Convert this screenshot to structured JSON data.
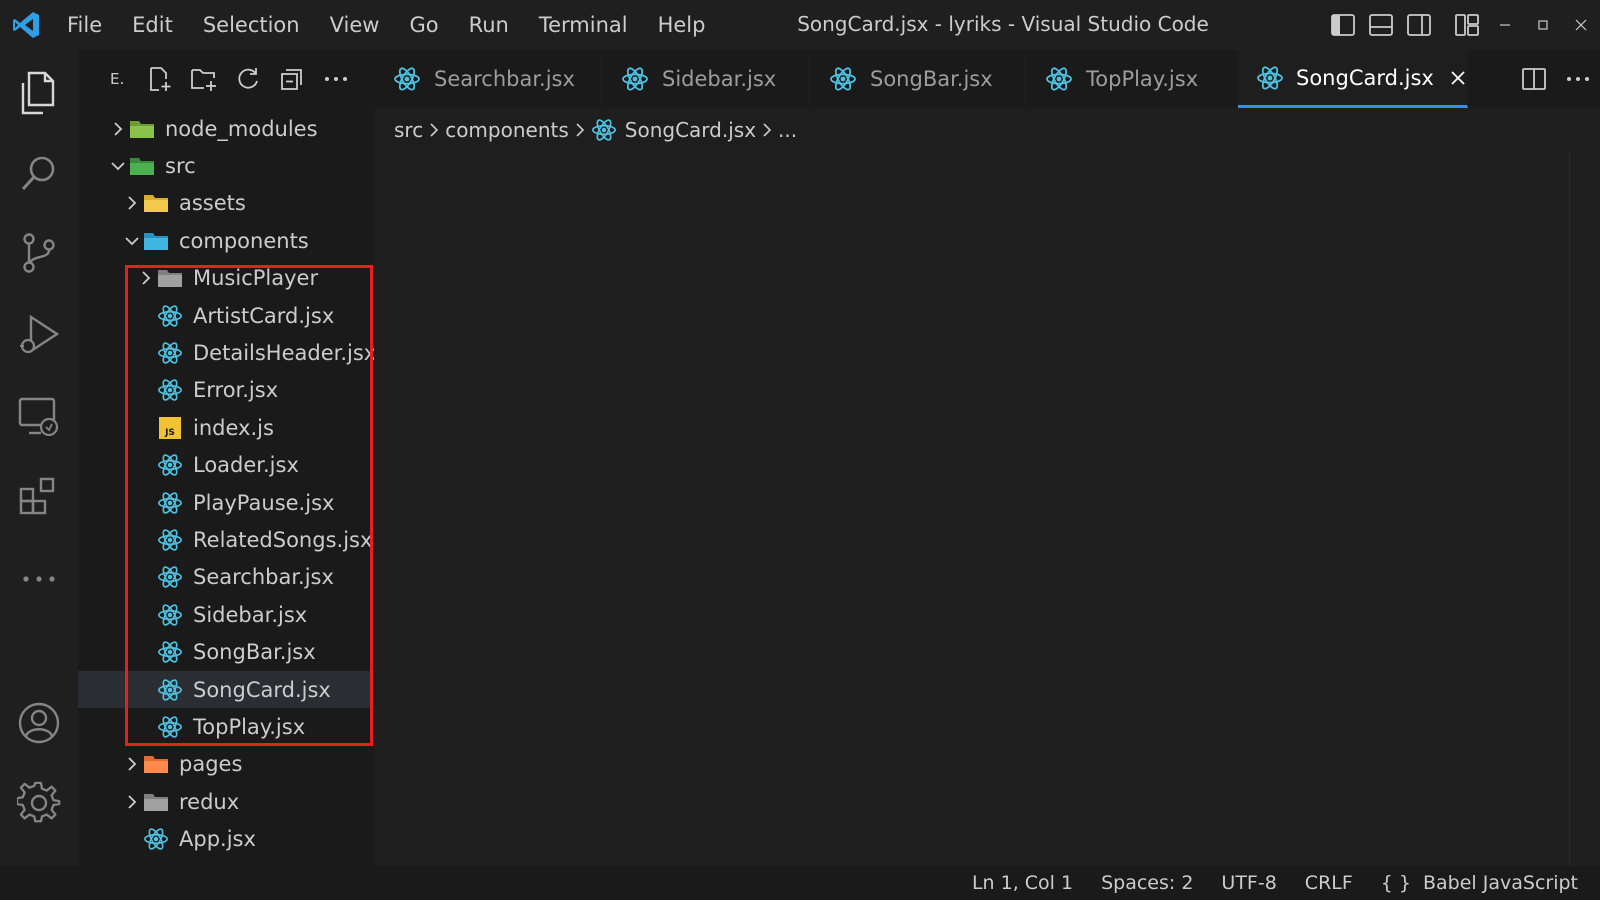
{
  "window": {
    "title": "SongCard.jsx - lyriks - Visual Studio Code",
    "accent_color": "#3c8dde",
    "highlight_color": "#e81f1f"
  },
  "menu": [
    "File",
    "Edit",
    "Selection",
    "View",
    "Go",
    "Run",
    "Terminal",
    "Help"
  ],
  "activity_bar": {
    "icons": [
      "files-icon",
      "search-icon",
      "source-control-icon",
      "run-debug-icon",
      "remote-explorer-icon",
      "extensions-icon",
      "more-icon",
      "account-icon",
      "settings-gear-icon"
    ]
  },
  "explorer": {
    "title": "E."
  },
  "tree": [
    {
      "label": "node_modules",
      "indent": 0,
      "type": "folder",
      "expanded": false,
      "icon": "folder-node-icon"
    },
    {
      "label": "src",
      "indent": 0,
      "type": "folder",
      "expanded": true,
      "icon": "folder-src-icon"
    },
    {
      "label": "assets",
      "indent": 1,
      "type": "folder",
      "expanded": false,
      "icon": "folder-assets-icon"
    },
    {
      "label": "components",
      "indent": 1,
      "type": "folder",
      "expanded": true,
      "icon": "folder-components-icon"
    },
    {
      "label": "MusicPlayer",
      "indent": 2,
      "type": "folder",
      "expanded": false,
      "icon": "folder-icon"
    },
    {
      "label": "ArtistCard.jsx",
      "indent": 2,
      "type": "file",
      "icon": "react-icon"
    },
    {
      "label": "DetailsHeader.jsx",
      "indent": 2,
      "type": "file",
      "icon": "react-icon"
    },
    {
      "label": "Error.jsx",
      "indent": 2,
      "type": "file",
      "icon": "react-icon"
    },
    {
      "label": "index.js",
      "indent": 2,
      "type": "file",
      "icon": "js-icon"
    },
    {
      "label": "Loader.jsx",
      "indent": 2,
      "type": "file",
      "icon": "react-icon"
    },
    {
      "label": "PlayPause.jsx",
      "indent": 2,
      "type": "file",
      "icon": "react-icon"
    },
    {
      "label": "RelatedSongs.jsx",
      "indent": 2,
      "type": "file",
      "icon": "react-icon"
    },
    {
      "label": "Searchbar.jsx",
      "indent": 2,
      "type": "file",
      "icon": "react-icon"
    },
    {
      "label": "Sidebar.jsx",
      "indent": 2,
      "type": "file",
      "icon": "react-icon"
    },
    {
      "label": "SongBar.jsx",
      "indent": 2,
      "type": "file",
      "icon": "react-icon"
    },
    {
      "label": "SongCard.jsx",
      "indent": 2,
      "type": "file",
      "icon": "react-icon",
      "selected": true
    },
    {
      "label": "TopPlay.jsx",
      "indent": 2,
      "type": "file",
      "icon": "react-icon"
    },
    {
      "label": "pages",
      "indent": 1,
      "type": "folder",
      "expanded": false,
      "icon": "folder-pages-icon"
    },
    {
      "label": "redux",
      "indent": 1,
      "type": "folder",
      "expanded": false,
      "icon": "folder-icon"
    },
    {
      "label": "App.jsx",
      "indent": 1,
      "type": "file",
      "icon": "react-icon"
    }
  ],
  "tabs": [
    {
      "label": "Searchbar.jsx",
      "active": false
    },
    {
      "label": "Sidebar.jsx",
      "active": false
    },
    {
      "label": "SongBar.jsx",
      "active": false
    },
    {
      "label": "TopPlay.jsx",
      "active": false
    },
    {
      "label": "SongCard.jsx",
      "active": true
    }
  ],
  "breadcrumb": [
    "src",
    "components",
    "SongCard.jsx",
    "..."
  ],
  "status": {
    "position": "Ln 1, Col 1",
    "spaces": "Spaces: 2",
    "encoding": "UTF-8",
    "eol": "CRLF",
    "language": "Babel JavaScript"
  }
}
